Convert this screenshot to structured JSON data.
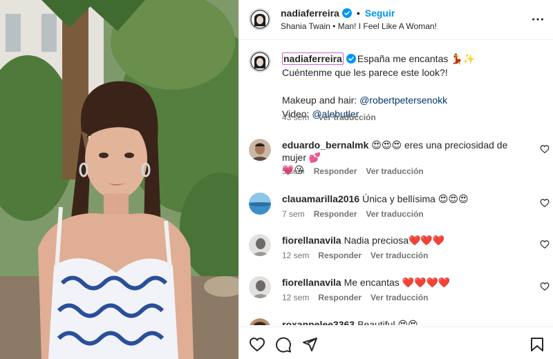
{
  "post": {
    "username": "nadiaferreira",
    "follow_label": "Seguir",
    "audio": "Shania Twain • Man! I Feel Like A Woman!",
    "caption": {
      "username": "nadiaferreira",
      "line1": "España me encantas 💃✨",
      "line2": "Cuéntenme que les parece este look?!",
      "makeup_label": "Makeup and hair: ",
      "makeup_handle": "@robertpetersenokk",
      "video_label": "Video: ",
      "video_handle": "@alebutler",
      "age": "43 sem",
      "translate": "Ver traducción"
    }
  },
  "comments": [
    {
      "username": "eduardo_bernalmk",
      "text": "😍😍😍 eres una preciosidad de mujer 💕",
      "text2": "💗😘",
      "age": "5 sem",
      "reply": "Responder",
      "translate": "Ver traducción"
    },
    {
      "username": "clauamarilla2016",
      "text": "Única y bellísima 😍😍😍",
      "age": "7 sem",
      "reply": "Responder",
      "translate": "Ver traducción"
    },
    {
      "username": "fiorellanavila",
      "text": "Nadia preciosa❤️❤️❤️",
      "age": "12 sem",
      "reply": "Responder",
      "translate": "Ver traducción"
    },
    {
      "username": "fiorellanavila",
      "text": "Me encantas ❤️❤️❤️❤️",
      "age": "12 sem",
      "reply": "Responder",
      "translate": "Ver traducción"
    },
    {
      "username": "roxannelee3363",
      "text": "Beautiful 😍😍"
    }
  ],
  "icons": {
    "verified": "verified-badge-icon",
    "more": "more-options-icon",
    "like": "heart-icon",
    "comment": "comment-icon",
    "share": "share-icon",
    "save": "bookmark-icon"
  },
  "colors": {
    "accent": "#0095f6",
    "link": "#00376b",
    "secondary_text": "#737373",
    "highlight_border": "#c964cf"
  }
}
